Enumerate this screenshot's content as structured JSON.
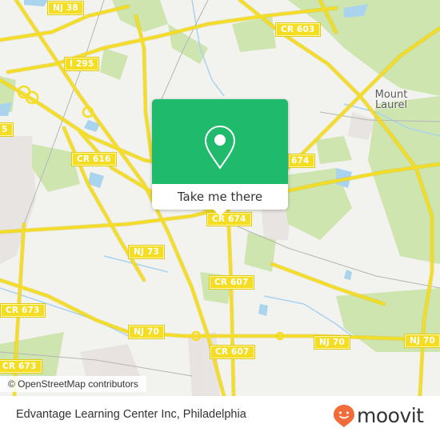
{
  "map": {
    "attribution": "© OpenStreetMap contributors",
    "colors": {
      "background": "#f2f2ee",
      "park": "#cfe5b0",
      "water": "#aad3ee",
      "road": "#f4dd22",
      "road_edge": "#e2c914",
      "landuse": "#e4dedb",
      "rail": "#b5b5b5"
    },
    "road_labels": [
      {
        "id": "nj38",
        "text": "NJ 38"
      },
      {
        "id": "cr603",
        "text": "CR 603"
      },
      {
        "id": "i295",
        "text": "I 295"
      },
      {
        "id": "cr616",
        "text": "CR 616"
      },
      {
        "id": "cr674a",
        "text": "CR 674"
      },
      {
        "id": "cr674b",
        "text": "674"
      },
      {
        "id": "nj73",
        "text": "NJ 73"
      },
      {
        "id": "cr607a",
        "text": "CR 607"
      },
      {
        "id": "cr607b",
        "text": "CR 607"
      },
      {
        "id": "cr673a",
        "text": "CR 673"
      },
      {
        "id": "cr673b",
        "text": "CR 673"
      },
      {
        "id": "nj70a",
        "text": "NJ 70"
      },
      {
        "id": "nj70b",
        "text": "NJ 70"
      },
      {
        "id": "nj70c",
        "text": "NJ 70"
      },
      {
        "id": "edge5",
        "text": "5"
      }
    ],
    "places": [
      {
        "id": "mount-laurel",
        "line1": "Mount",
        "line2": "Laurel"
      }
    ]
  },
  "popup": {
    "icon": "map-pin-icon",
    "button_label": "Take me there",
    "accent_color": "#1fba6b"
  },
  "footer": {
    "title": "Edvantage Learning Center Inc, Philadelphia",
    "brand": "moovit",
    "brand_color": "#f26b3a"
  }
}
